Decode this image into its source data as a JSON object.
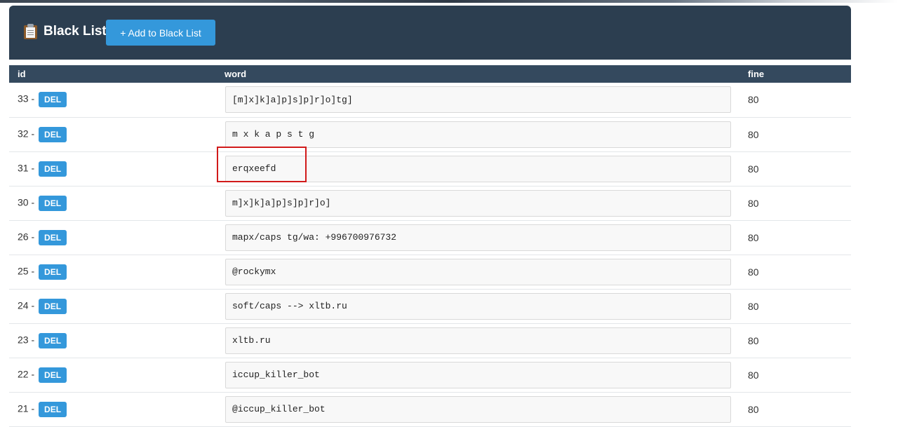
{
  "header": {
    "title": "Black List",
    "add_button": "+ Add to Black List"
  },
  "table": {
    "columns": [
      "id",
      "word",
      "fine"
    ],
    "del_label": "DEL",
    "id_separator": " - ",
    "rows": [
      {
        "id": "33",
        "word": "[m]x]k]a]p]s]p]r]o]tg]",
        "fine": "80"
      },
      {
        "id": "32",
        "word": "m x k a p s t g",
        "fine": "80"
      },
      {
        "id": "31",
        "word": "erqxeefd",
        "fine": "80"
      },
      {
        "id": "30",
        "word": "m]x]k]a]p]s]p]r]o]",
        "fine": "80"
      },
      {
        "id": "26",
        "word": "mapx/caps tg/wa: +996700976732",
        "fine": "80"
      },
      {
        "id": "25",
        "word": "@rockymx",
        "fine": "80"
      },
      {
        "id": "24",
        "word": "soft/caps --> xltb.ru",
        "fine": "80"
      },
      {
        "id": "23",
        "word": "xltb.ru",
        "fine": "80"
      },
      {
        "id": "22",
        "word": "iccup_killer_bot",
        "fine": "80"
      },
      {
        "id": "21",
        "word": "@iccup_killer_bot",
        "fine": "80"
      }
    ]
  },
  "colors": {
    "header_bg": "#2c3e50",
    "table_header_bg": "#34495e",
    "accent": "#3498db",
    "highlight": "#d11a1a"
  },
  "icons": {
    "title_icon": "clipboard-icon"
  }
}
